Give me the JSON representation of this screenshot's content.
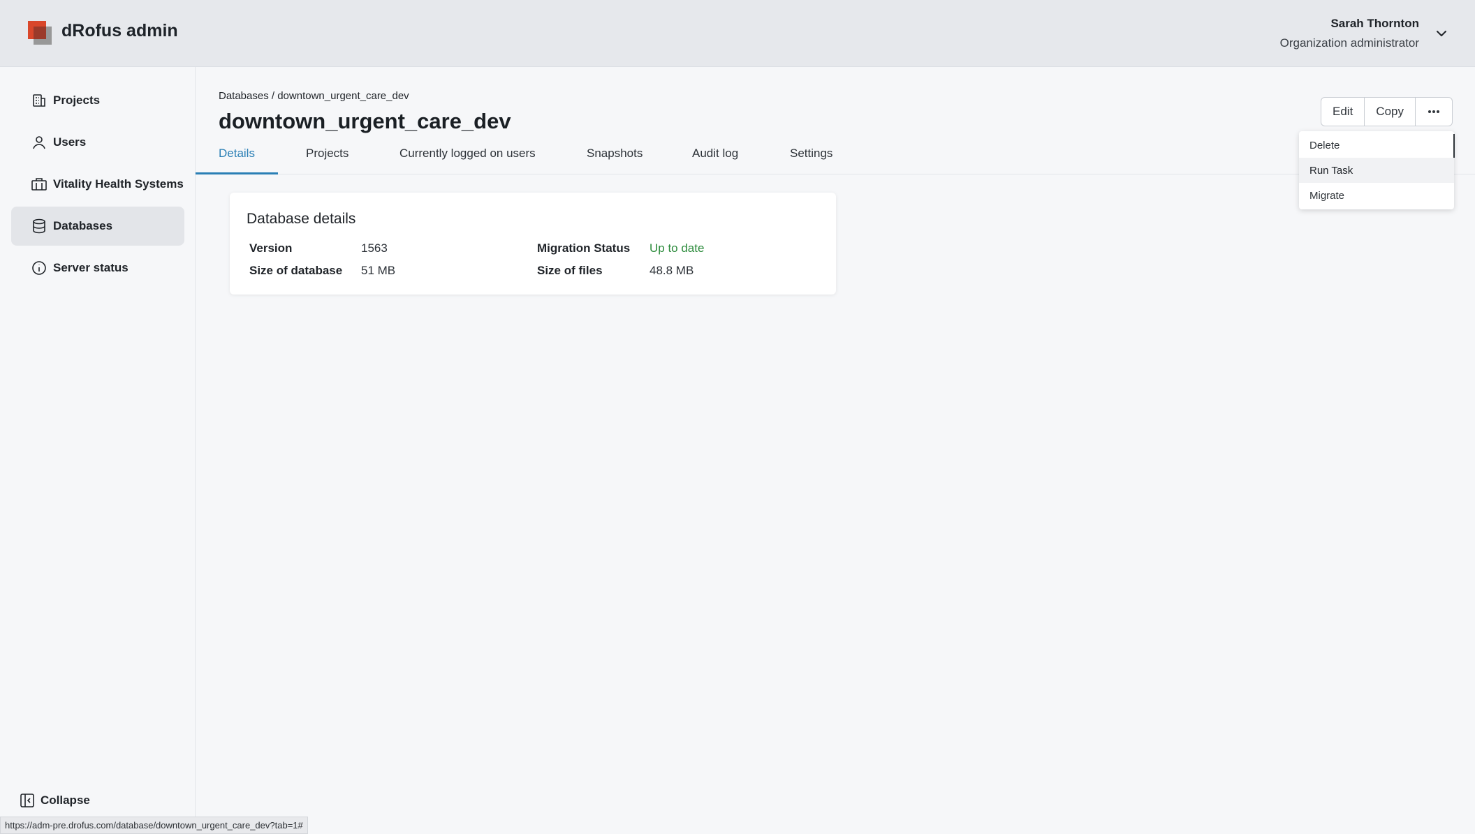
{
  "header": {
    "app_title": "dRofus admin",
    "user_name": "Sarah Thornton",
    "user_role": "Organization administrator"
  },
  "sidebar": {
    "items": [
      {
        "label": "Projects",
        "icon": "building-icon"
      },
      {
        "label": "Users",
        "icon": "user-icon"
      },
      {
        "label": "Vitality Health Systems",
        "icon": "organization-icon"
      },
      {
        "label": "Databases",
        "icon": "database-icon",
        "active": true
      },
      {
        "label": "Server status",
        "icon": "info-icon"
      }
    ],
    "collapse_label": "Collapse"
  },
  "main": {
    "breadcrumb": "Databases / downtown_urgent_care_dev",
    "title": "downtown_urgent_care_dev",
    "tabs": [
      {
        "label": "Details",
        "active": true
      },
      {
        "label": "Projects"
      },
      {
        "label": "Currently logged on users"
      },
      {
        "label": "Snapshots"
      },
      {
        "label": "Audit log"
      },
      {
        "label": "Settings"
      }
    ],
    "actions": {
      "edit_label": "Edit",
      "copy_label": "Copy",
      "more_icon": "ellipsis-icon"
    },
    "dropdown": {
      "items": [
        "Delete",
        "Run Task",
        "Migrate"
      ],
      "hovered": "Run Task"
    },
    "card": {
      "title": "Database details",
      "version_label": "Version",
      "version_value": "1563",
      "size_db_label": "Size of database",
      "size_db_value": "51 MB",
      "migration_label": "Migration Status",
      "migration_value": "Up to date",
      "size_files_label": "Size of files",
      "size_files_value": "48.8 MB"
    }
  },
  "status_bar": {
    "url": "https://adm-pre.drofus.com/database/downtown_urgent_care_dev?tab=1#"
  },
  "colors": {
    "accent": "#2a7fb5",
    "ok": "#2a8a3a",
    "brand": "#d9472b"
  }
}
